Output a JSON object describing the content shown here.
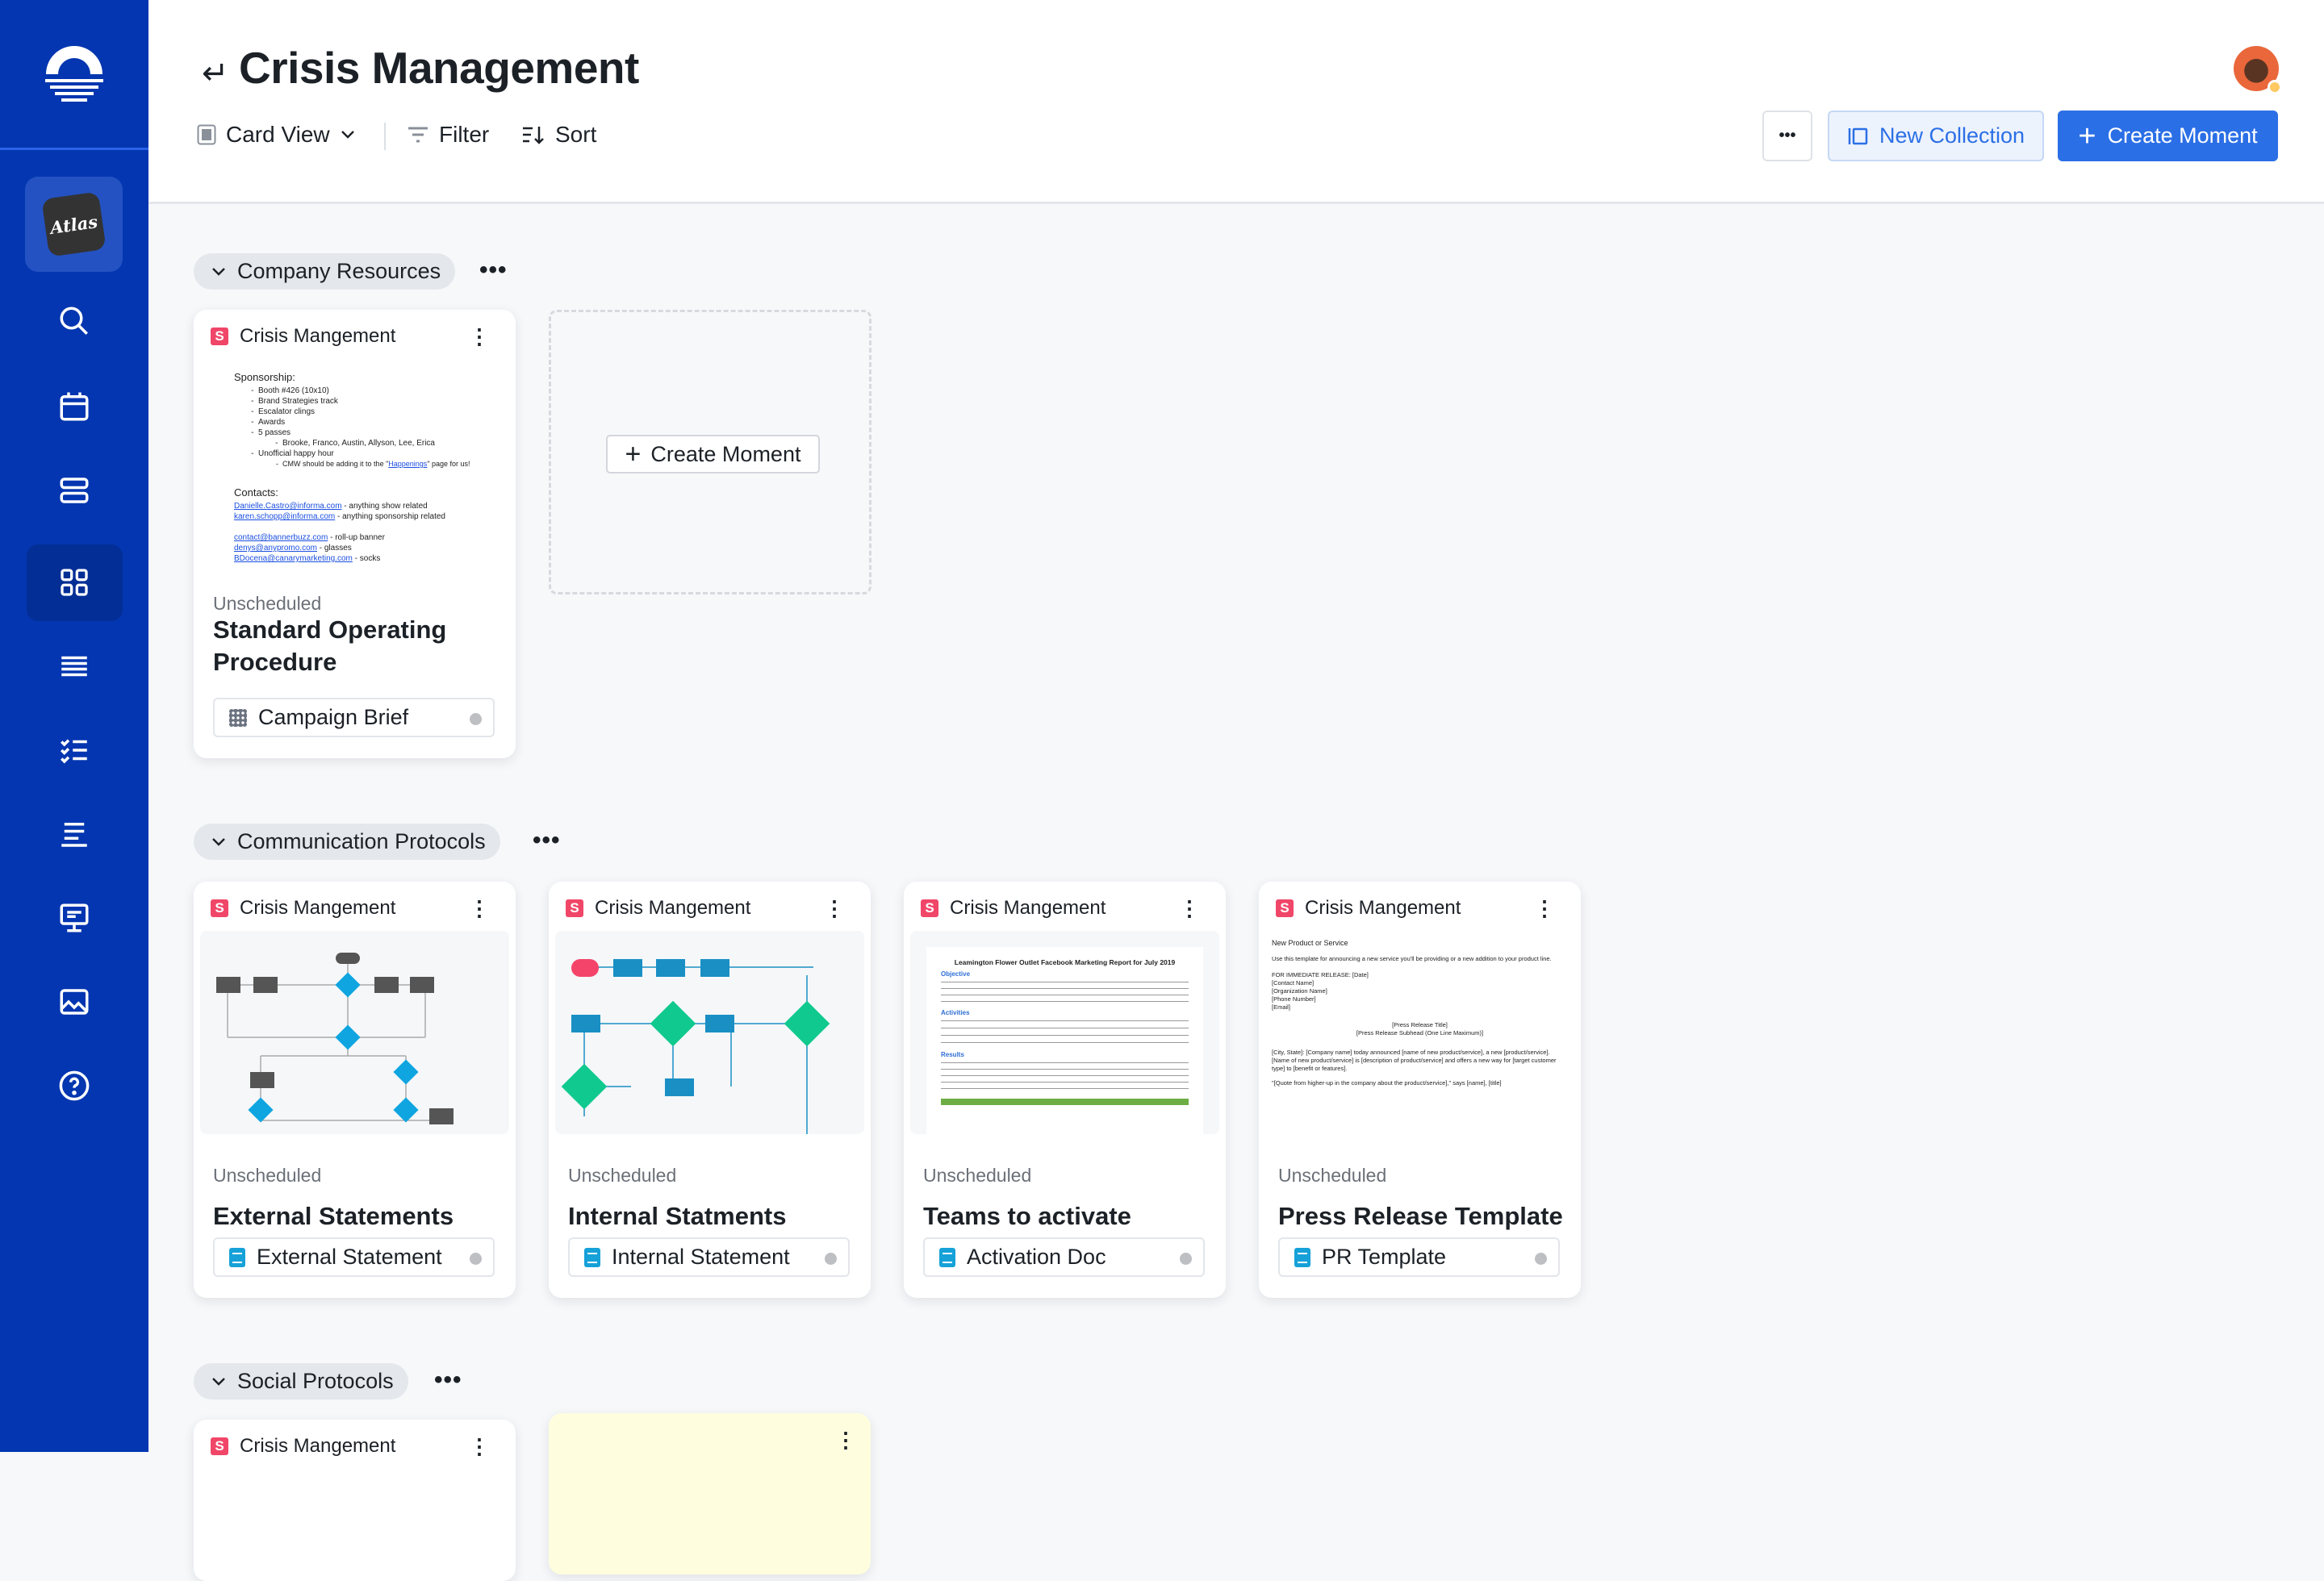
{
  "sidebar": {
    "logo": "sunrise-logo",
    "workspace_label": "Atlas",
    "items": [
      {
        "name": "search",
        "icon": "search-icon"
      },
      {
        "name": "calendar",
        "icon": "calendar-icon"
      },
      {
        "name": "stack",
        "icon": "stack-icon"
      },
      {
        "name": "collections",
        "icon": "grid-icon",
        "active": true
      },
      {
        "name": "timeline",
        "icon": "lines-icon"
      },
      {
        "name": "checklist",
        "icon": "checklist-icon"
      },
      {
        "name": "list",
        "icon": "list-icon"
      },
      {
        "name": "presentation",
        "icon": "presentation-icon"
      },
      {
        "name": "media",
        "icon": "image-icon"
      },
      {
        "name": "help",
        "icon": "help-icon"
      }
    ]
  },
  "header": {
    "back_icon": "↵",
    "title": "Crisis Management",
    "view_label": "Card View",
    "filter_label": "Filter",
    "sort_label": "Sort",
    "more_label": "•••",
    "new_collection_label": "New Collection",
    "create_moment_label": "Create Moment"
  },
  "colors": {
    "sidebar": "#0336b0",
    "primary": "#2b6fe6",
    "badge": "#f04668",
    "doc_icon": "#16a1d8"
  },
  "sections": [
    {
      "title": "Company Resources",
      "more": "•••",
      "cards": [
        {
          "source": "Crisis Mangement",
          "badge": "S",
          "status": "Unscheduled",
          "title": "Standard Operating Procedure",
          "chip": "Campaign Brief",
          "preview": {
            "heading": "Sponsorship:",
            "bullets": [
              "Booth #426 (10x10)",
              "Brand Strategies track",
              "Escalator clings",
              "Awards",
              "5 passes"
            ],
            "sub1": "Brooke, Franco, Austin, Allyson, Lee, Erica",
            "bullet6": "Unofficial happy hour",
            "sub2_pre": "CMW should be adding it to the \"",
            "sub2_link": "Happenings",
            "sub2_post": "\" page for us!",
            "contacts_heading": "Contacts:",
            "contacts": [
              {
                "email": "Danielle.Castro@informa.com",
                "note": " - anything show related"
              },
              {
                "email": "karen.schopp@informa.com",
                "note": " - anything sponsorship related"
              },
              {
                "email": "contact@bannerbuzz.com",
                "note": " - roll-up banner"
              },
              {
                "email": "denys@anypromo.com",
                "note": " - glasses"
              },
              {
                "email": "BDocena@canarymarketing.com",
                "note": " - socks"
              }
            ]
          }
        }
      ],
      "create_moment_label": "Create Moment"
    },
    {
      "title": "Communication Protocols",
      "more": "•••",
      "cards": [
        {
          "source": "Crisis Mangement",
          "badge": "S",
          "status": "Unscheduled",
          "title": "External Statements",
          "chip": "External Statement"
        },
        {
          "source": "Crisis Mangement",
          "badge": "S",
          "status": "Unscheduled",
          "title": "Internal Statments",
          "chip": "Internal Statement"
        },
        {
          "source": "Crisis Mangement",
          "badge": "S",
          "status": "Unscheduled",
          "title": "Teams to activate",
          "chip": "Activation Doc",
          "preview": {
            "heading": "Leamington Flower Outlet Facebook Marketing Report for July 2019",
            "s1": "Objective",
            "s2": "Activities",
            "s3": "Results"
          }
        },
        {
          "source": "Crisis Mangement",
          "badge": "S",
          "status": "Unscheduled",
          "title": "Press Release Template",
          "chip": "PR Template",
          "preview": {
            "heading": "New Product or Service",
            "intro": "Use this template for announcing a new service you'll be providing or a new addition to your product line.",
            "lines": [
              "FOR IMMEDIATE RELEASE: [Date]",
              "[Contact Name]",
              "[Organization Name]",
              "[Phone Number]",
              "[Email]"
            ],
            "t1": "[Press Release Title]",
            "t2": "[Press Release Subhead (One Line Maximum)]",
            "body": "[City, State]: [Company name] today announced [name of new product/service], a new [product/service]. [Name of new product/service] is [description of product/service] and offers a new way for [target customer type] to [benefit or features].",
            "quote": "\"[Quote from higher-up in the company about the product/service],\" says [name], [title]"
          }
        }
      ]
    },
    {
      "title": "Social Protocols",
      "more": "•••",
      "cards": [
        {
          "source": "Crisis Mangement",
          "badge": "S"
        }
      ]
    }
  ]
}
